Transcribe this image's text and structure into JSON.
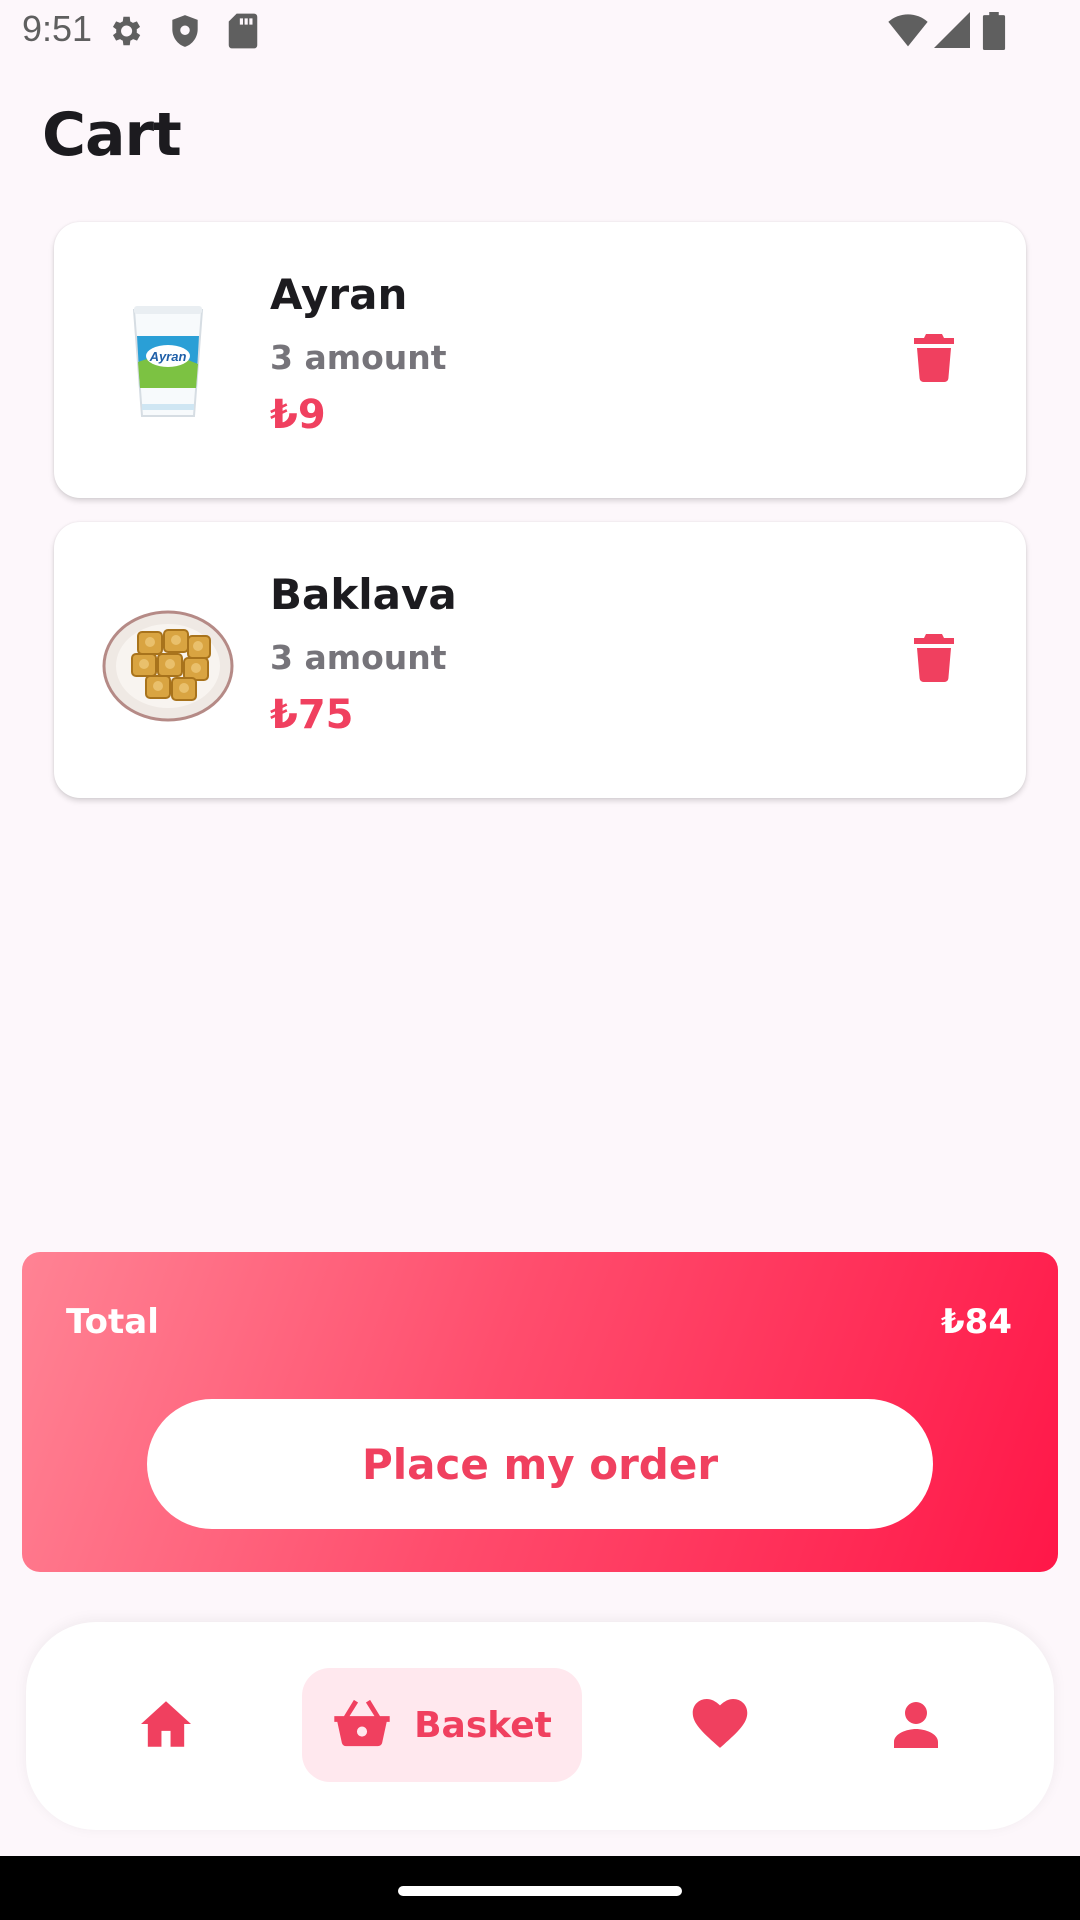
{
  "status_bar": {
    "time": "9:51",
    "left_icons": [
      "settings-icon",
      "shield-icon",
      "sd-card-icon"
    ],
    "right_icons": [
      "wifi-icon",
      "signal-icon",
      "battery-icon"
    ]
  },
  "page": {
    "title": "Cart"
  },
  "cart": {
    "items": [
      {
        "name": "Ayran",
        "quantity": "3 amount",
        "price": "₺9",
        "image": "ayran-cup-image"
      },
      {
        "name": "Baklava",
        "quantity": "3 amount",
        "price": "₺75",
        "image": "baklava-plate-image"
      }
    ]
  },
  "summary": {
    "total_label": "Total",
    "total_value": "₺84",
    "place_order_label": "Place my order"
  },
  "bottom_nav": {
    "items": [
      {
        "id": "home",
        "icon": "home-icon"
      },
      {
        "id": "basket",
        "icon": "basket-icon",
        "label": "Basket",
        "active": true
      },
      {
        "id": "favorites",
        "icon": "heart-icon"
      },
      {
        "id": "profile",
        "icon": "person-icon"
      }
    ]
  },
  "colors": {
    "accent": "#f0405f",
    "background": "#fdf7fb",
    "nav_active_bg": "#ffe8ee"
  }
}
